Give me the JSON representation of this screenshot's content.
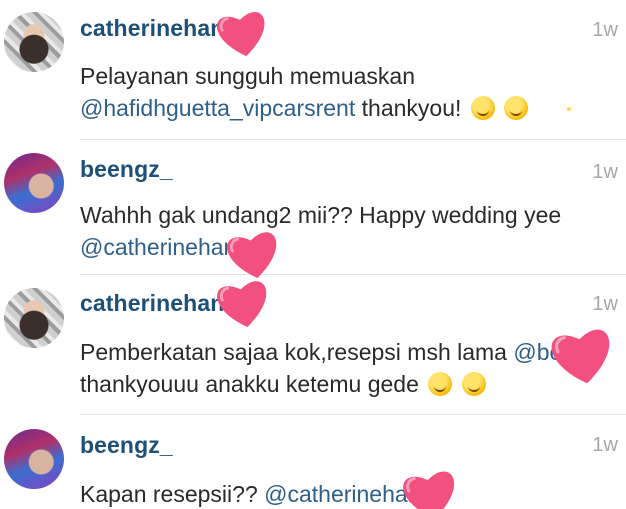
{
  "comments": [
    {
      "username": "catherinehan",
      "time": "1w",
      "text_before": "Pelayanan sungguh memuaskan",
      "mention": "@hafidhguetta_vipcarsrent",
      "text_after": " thankyou!",
      "emoji": "smiling-face-emoji"
    },
    {
      "username": "beengz_",
      "time": "1w",
      "text_before": "Wahhh gak undang2 mii?? Happy wedding yee",
      "mention": "@catherinehan",
      "text_after": ""
    },
    {
      "username": "catherinehan",
      "time": "1w",
      "text_before": "Pemberkatan sajaa kok,resepsi msh lama ",
      "mention": "@bee",
      "text_after": "thankyouuu anakku ketemu gede",
      "emoji": "kissing-face-emoji"
    },
    {
      "username": "beengz_",
      "time": "1w",
      "text_before": "Kapan resepsii?? ",
      "mention": "@catherinehan",
      "text_after": ""
    }
  ],
  "sticker": {
    "icon": "heart-sticker",
    "color": "#f2507f"
  }
}
